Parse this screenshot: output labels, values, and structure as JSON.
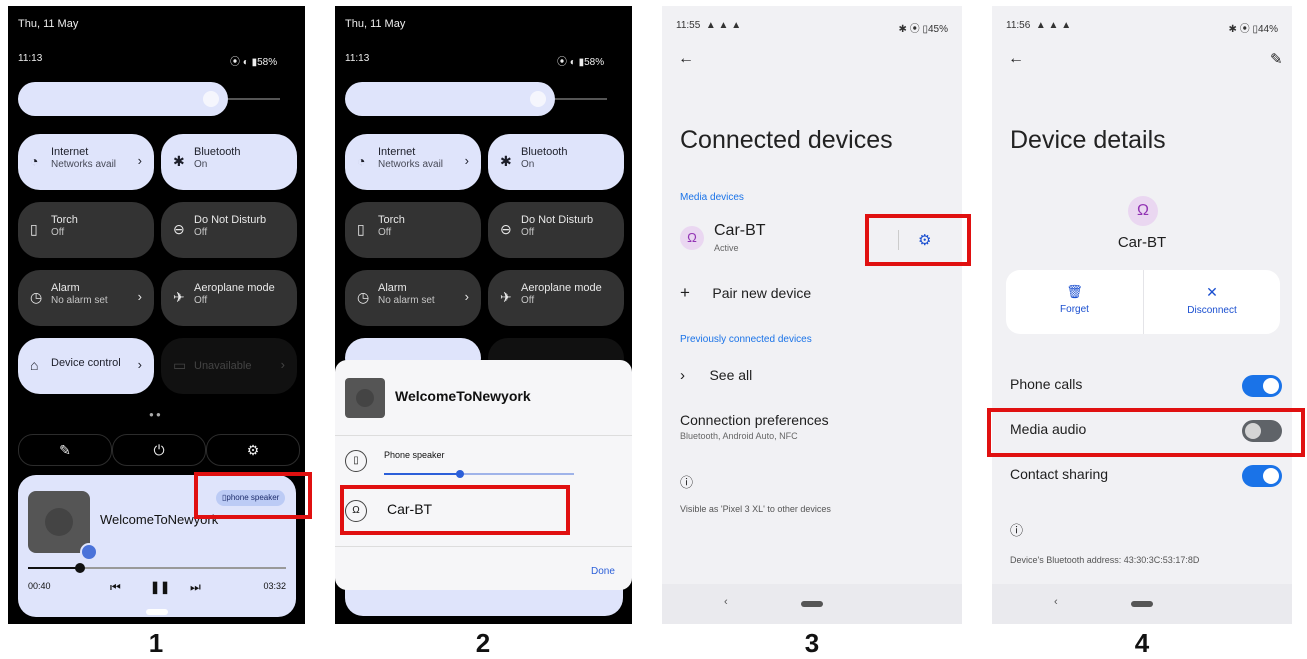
{
  "labels": [
    "1",
    "2",
    "3",
    "4"
  ],
  "screen1": {
    "date": "Thu, 11 May",
    "time": "11:13",
    "battery": "58%",
    "tiles": [
      {
        "title": "Internet",
        "sub": "Networks avail",
        "icon": "wifi-icon",
        "state": "on"
      },
      {
        "title": "Bluetooth",
        "sub": "On",
        "icon": "bluetooth-icon",
        "state": "on"
      },
      {
        "title": "Torch",
        "sub": "Off",
        "icon": "flashlight-icon",
        "state": "off"
      },
      {
        "title": "Do Not Disturb",
        "sub": "Off",
        "icon": "dnd-icon",
        "state": "off"
      },
      {
        "title": "Alarm",
        "sub": "No alarm set",
        "icon": "alarm-icon",
        "state": "off"
      },
      {
        "title": "Aeroplane mode",
        "sub": "Off",
        "icon": "airplane-icon",
        "state": "off"
      },
      {
        "title": "Device control",
        "icon": "home-icon",
        "state": "on"
      },
      {
        "title": "Unavailable",
        "icon": "card-icon",
        "state": "dim"
      }
    ],
    "media": {
      "title": "WelcomeToNewyork",
      "output_chip": "phone speaker",
      "elapsed": "00:40",
      "duration": "03:32",
      "progress": 0.2
    }
  },
  "screen2": {
    "date": "Thu, 11 May",
    "time": "11:13",
    "battery": "58%",
    "tiles": [
      {
        "title": "Internet",
        "sub": "Networks avail",
        "state": "on"
      },
      {
        "title": "Bluetooth",
        "sub": "On",
        "state": "on"
      },
      {
        "title": "Torch",
        "sub": "Off",
        "state": "off"
      },
      {
        "title": "Do Not Disturb",
        "sub": "Off",
        "state": "off"
      },
      {
        "title": "Alarm",
        "sub": "No alarm set",
        "state": "off"
      },
      {
        "title": "Aeroplane mode",
        "sub": "Off",
        "state": "off"
      }
    ],
    "dialog": {
      "title": "WelcomeToNewyork",
      "speaker_label": "Phone speaker",
      "volume": 0.4,
      "device": "Car-BT",
      "done": "Done"
    }
  },
  "screen3": {
    "time": "11:55",
    "battery": "45%",
    "title": "Connected devices",
    "media_header": "Media devices",
    "device_name": "Car-BT",
    "device_status": "Active",
    "pair_new": "Pair new device",
    "prev_header": "Previously connected devices",
    "see_all": "See all",
    "conn_pref": "Connection preferences",
    "conn_pref_sub": "Bluetooth, Android Auto, NFC",
    "visible_as": "Visible as 'Pixel 3 XL' to other devices"
  },
  "screen4": {
    "time": "11:56",
    "battery": "44%",
    "title": "Device details",
    "device_name": "Car-BT",
    "forget": "Forget",
    "disconnect": "Disconnect",
    "toggles": [
      {
        "label": "Phone calls",
        "on": true
      },
      {
        "label": "Media audio",
        "on": false
      },
      {
        "label": "Contact sharing",
        "on": true
      }
    ],
    "bt_address": "Device's Bluetooth address: 43:30:3C:53:17:8D"
  }
}
